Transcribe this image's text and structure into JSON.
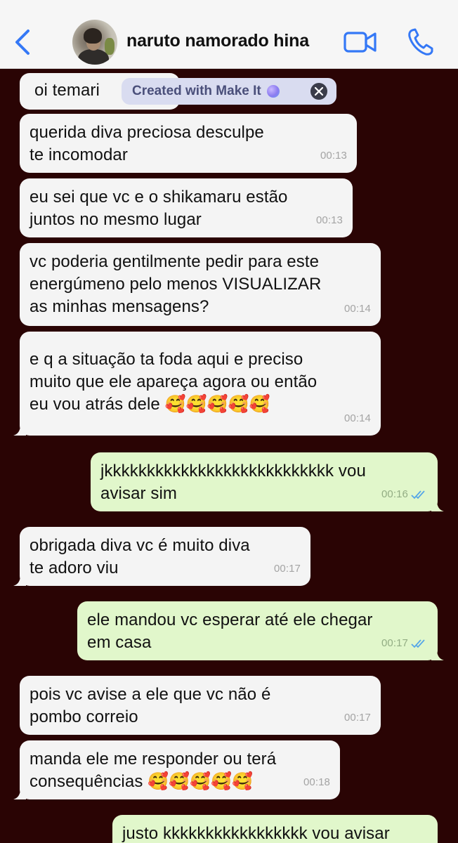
{
  "header": {
    "contact_name": "naruto namorado hina",
    "back_icon": "chevron-left-icon",
    "video_icon": "video-camera-icon",
    "call_icon": "phone-icon",
    "accent_color": "#3478f6"
  },
  "watermark": {
    "label": "Created with Make It"
  },
  "messages": [
    {
      "direction": "in",
      "text": "oi temari",
      "time": ""
    },
    {
      "direction": "in",
      "text": " querida diva preciosa desculpe\nte incomodar",
      "time": "00:13"
    },
    {
      "direction": "in",
      "text": "eu sei que vc e o shikamaru estão\njuntos no mesmo lugar",
      "time": "00:13"
    },
    {
      "direction": "in",
      "text": "vc poderia gentilmente pedir para este\nenergúmeno pelo menos VISUALIZAR\nas minhas mensagens?",
      "time": "00:14"
    },
    {
      "direction": "in",
      "text": "e q a situação ta foda aqui e preciso\nmuito que ele apareça agora ou então\neu vou atrás dele 🥰🥰🥰🥰🥰",
      "time": "00:14"
    },
    {
      "direction": "out",
      "text": " jkkkkkkkkkkkkkkkkkkkkkkkkkkk vou\navisar sim",
      "time": "00:16"
    },
    {
      "direction": "in",
      "text": "obrigada diva vc é muito diva\nte adoro viu",
      "time": "00:17"
    },
    {
      "direction": "out",
      "text": "ele mandou vc esperar até ele chegar\nem casa",
      "time": "00:17"
    },
    {
      "direction": "in",
      "text": "pois vc avise a ele que vc não é\npombo correio",
      "time": "00:17"
    },
    {
      "direction": "in",
      "text": "manda ele me responder ou terá\nconsequências 🥰🥰🥰🥰🥰",
      "time": "00:18"
    },
    {
      "direction": "out",
      "text": " justo kkkkkkkkkkkkkkkkk vou avisar",
      "time": ""
    }
  ]
}
